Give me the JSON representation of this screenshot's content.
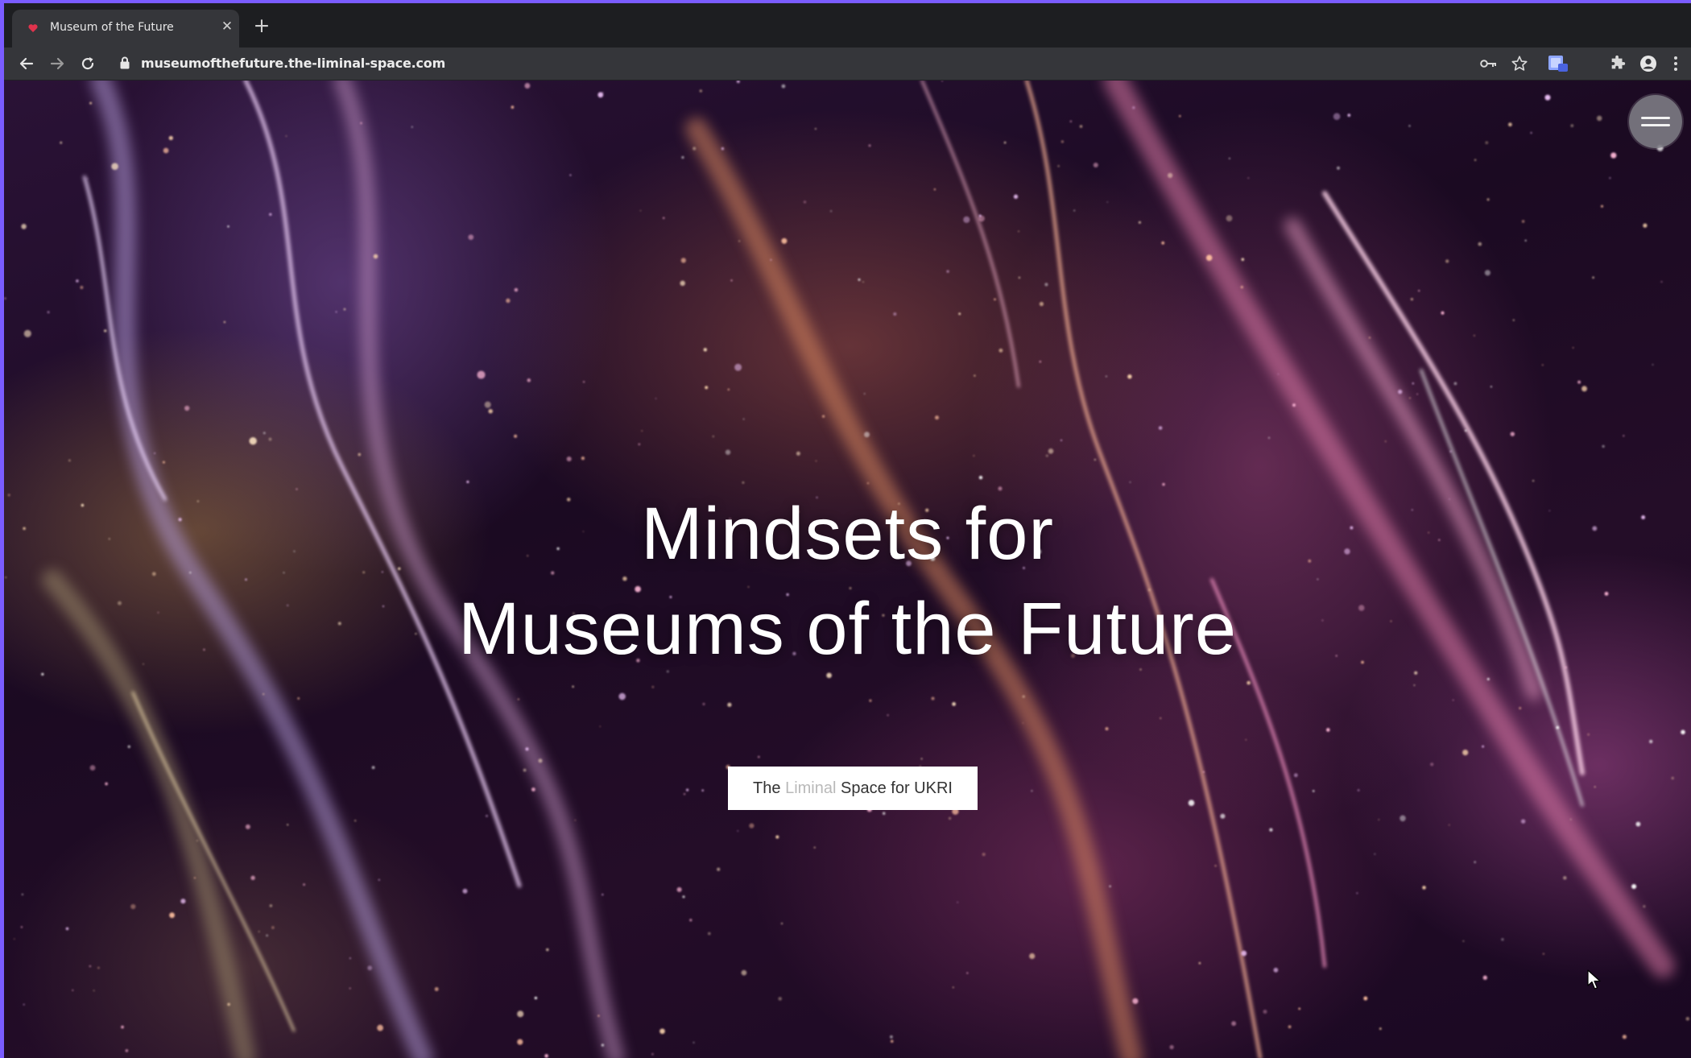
{
  "browser": {
    "tab": {
      "title": "Museum of the Future",
      "favicon": "heart-favicon-icon",
      "close_icon": "close-icon"
    },
    "new_tab_icon": "plus-icon",
    "nav": {
      "back_icon": "arrow-left-icon",
      "forward_icon": "arrow-right-icon",
      "reload_icon": "reload-icon"
    },
    "address_bar": {
      "lock_icon": "lock-icon",
      "url": "museumofthefuture.the-liminal-space.com"
    },
    "toolbar_icons": [
      "key-icon",
      "star-icon",
      "extension-badge-icon",
      "puzzle-icon",
      "profile-icon",
      "kebab-menu-icon"
    ]
  },
  "page": {
    "hero": {
      "title_line_1": "Mindsets for",
      "title_line_2": "Museums of the Future"
    },
    "cta": {
      "part_1": "The ",
      "part_2": "Liminal",
      "part_3": " Space for UKRI"
    },
    "menu_icon": "hamburger-menu-icon"
  },
  "colors": {
    "window_border": "#7a5cff",
    "chrome_dark": "#1d1e21",
    "chrome_toolbar": "#35363a",
    "background_deep": "#1b0a22",
    "accent_pink": "#d86aa8",
    "accent_orange": "#e08a5a",
    "cta_background": "#ffffff"
  }
}
